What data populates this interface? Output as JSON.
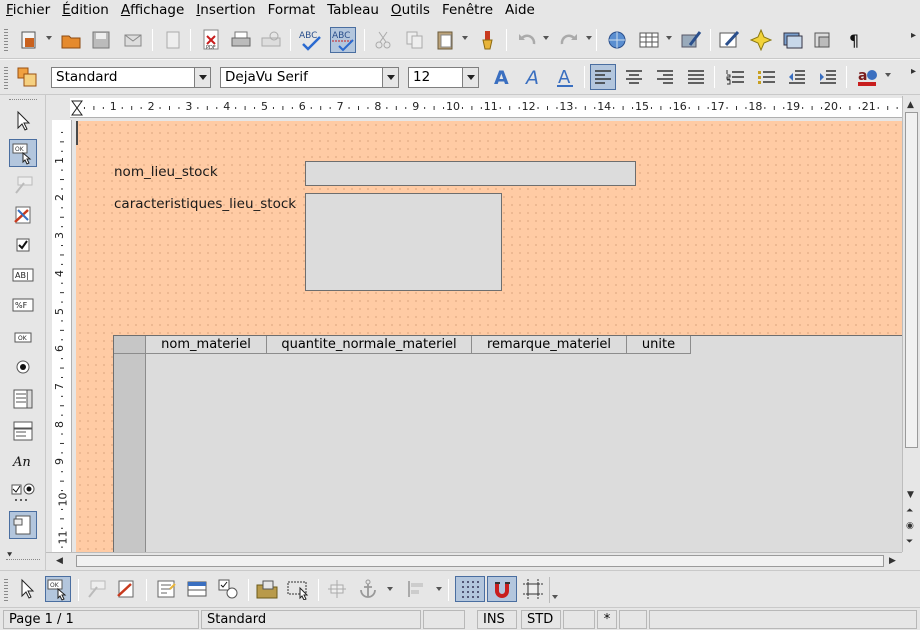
{
  "menu": {
    "items": [
      "Fichier",
      "Édition",
      "Affichage",
      "Insertion",
      "Format",
      "Tableau",
      "Outils",
      "Fenêtre",
      "Aide"
    ],
    "underlined": [
      "F",
      "É",
      "A",
      "I",
      "",
      "",
      "O",
      "",
      ""
    ]
  },
  "formatting": {
    "style": "Standard",
    "font": "DejaVu Serif",
    "size": "12"
  },
  "form": {
    "label_name": "nom_lieu_stock",
    "label_characteristics": "caracteristiques_lieu_stock",
    "grid_columns": [
      "nom_materiel",
      "quantite_normale_materiel",
      "remarque_materiel",
      "unite"
    ]
  },
  "ruler": {
    "h_numbers": [
      "1",
      "2",
      "3",
      "4",
      "5",
      "6",
      "7",
      "8",
      "9",
      "10",
      "11",
      "12",
      "13",
      "14",
      "15",
      "16",
      "17",
      "18",
      "19",
      "20",
      "21"
    ],
    "v_numbers": [
      "1",
      "2",
      "3",
      "4",
      "5",
      "6",
      "7",
      "8",
      "9",
      "10",
      "11"
    ]
  },
  "status": {
    "page": "Page 1 / 1",
    "style": "Standard",
    "mode_insert": "INS",
    "mode_select": "STD",
    "modified": "*"
  },
  "colors": {
    "page_background": "#ffcba4",
    "control_fill": "#dcdcdc",
    "selection": "#b3c6dd"
  },
  "icons": {
    "format_icons": [
      "bold-a-icon",
      "italic-a-icon",
      "underline-a-icon",
      "align-left-icon",
      "align-center-icon",
      "align-right-icon",
      "justify-icon",
      "numbering-icon",
      "bullets-icon",
      "decrease-indent-icon",
      "increase-indent-icon",
      "char-color-icon"
    ]
  }
}
